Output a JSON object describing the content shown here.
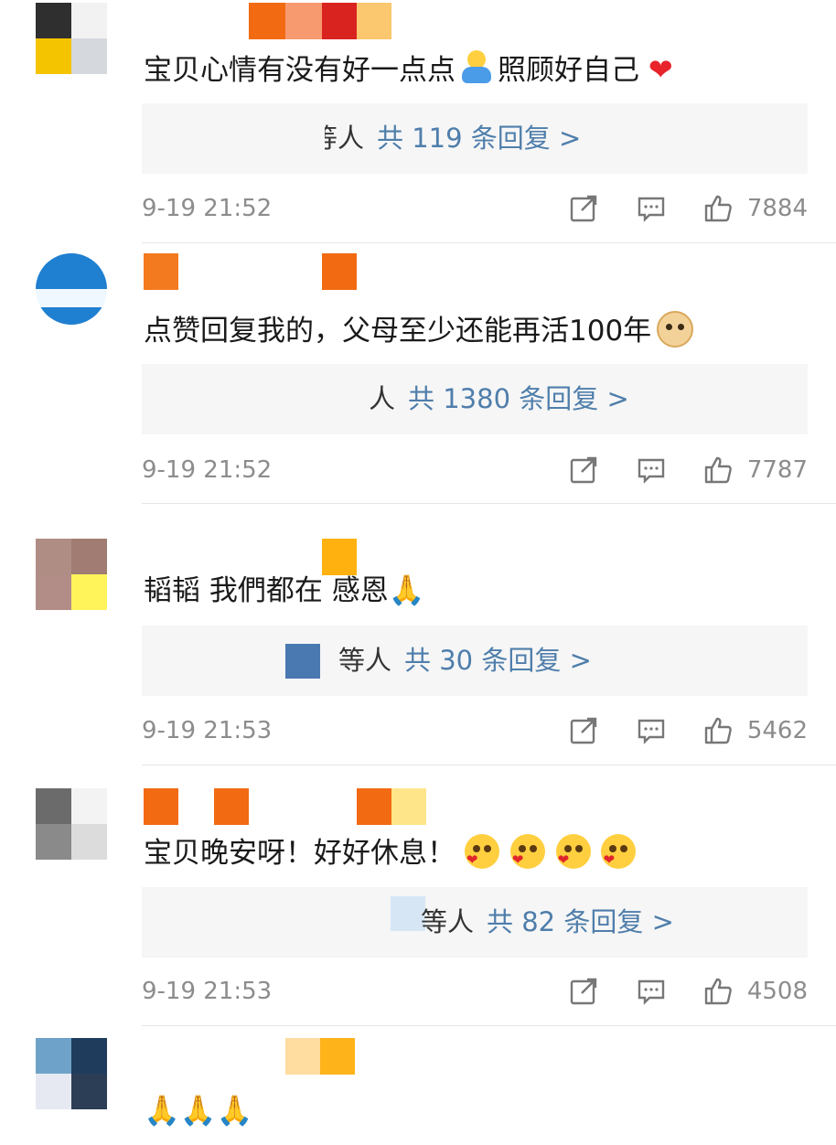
{
  "colors": {
    "reply_count": "#4f7eab",
    "meta_text": "#8c8c8c",
    "reply_box_bg": "#f6f6f6"
  },
  "comments": [
    {
      "text": "宝贝心情有没有好一点点",
      "text_tail": "照顾好自己",
      "reply_who": "等人",
      "reply_count": "共 119 条回复 >",
      "time": "9-19 21:52",
      "likes": "7884"
    },
    {
      "text": "点赞回复我的，父母至少还能再活100年",
      "reply_who": "人",
      "reply_count": "共 1380 条回复 >",
      "time": "9-19 21:52",
      "likes": "7787"
    },
    {
      "text": "韬韬 我們都在 感恩",
      "reply_who": "等人",
      "reply_count": "共 30 条回复 >",
      "time": "9-19 21:53",
      "likes": "5462"
    },
    {
      "text": "宝贝晚安呀！好好休息！",
      "reply_who": "等人",
      "reply_count": "共 82 条回复 >",
      "time": "9-19 21:53",
      "likes": "4508"
    }
  ],
  "icons": {
    "share": "share-icon",
    "reply": "comment-icon",
    "like": "thumbs-up-icon"
  }
}
